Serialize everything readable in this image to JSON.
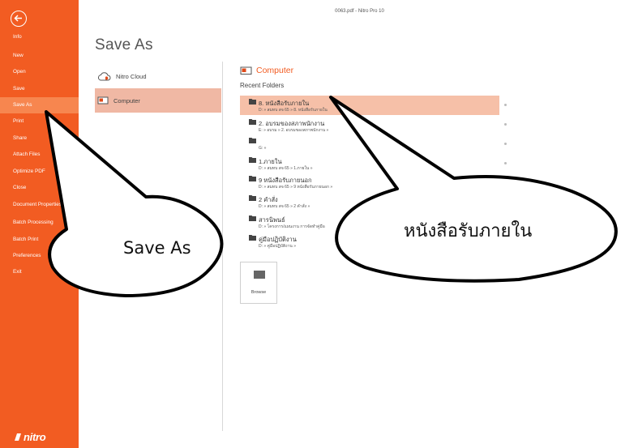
{
  "window": {
    "title": "0063.pdf - Nitro Pro 10"
  },
  "nav": {
    "back_icon": "back-arrow-icon",
    "items": [
      {
        "label": "Info"
      },
      {
        "label": "New"
      },
      {
        "label": "Open"
      },
      {
        "label": "Save"
      },
      {
        "label": "Save As",
        "active": true
      },
      {
        "label": "Print"
      },
      {
        "label": "Share"
      },
      {
        "label": "Attach Files"
      },
      {
        "label": "Optimize PDF"
      },
      {
        "label": "Close"
      },
      {
        "label": "Document Properties"
      },
      {
        "label": "Batch Processing"
      },
      {
        "label": "Batch Print"
      },
      {
        "label": "Preferences"
      },
      {
        "label": "Exit"
      }
    ],
    "logo": "nitro"
  },
  "main": {
    "title": "Save As",
    "locations": [
      {
        "label": "Nitro Cloud",
        "icon": "cloud-icon"
      },
      {
        "label": "Computer",
        "icon": "computer-icon",
        "active": true
      }
    ],
    "section_title": "Computer",
    "recent_title": "Recent Folders",
    "folders": [
      {
        "name": "8. หนังสือรับภายใน",
        "path": "D: » สมทบ สจ 65 » 8. หนังสือรับภายใน",
        "active": true
      },
      {
        "name": "2. อบรมของสภาพนักงาน",
        "path": "E: » อบรม » 2. อบรมของสภาพนักงาน »"
      },
      {
        "name": "",
        "path": "G: »"
      },
      {
        "name": "1.ภายใน",
        "path": "D: » สมทบ สจ 65 » 1.ภายใน »"
      },
      {
        "name": "9 หนังสือรับภายนอก",
        "path": "D: » สมทบ สจ 65 » 9 หนังสือรับภายนอก »"
      },
      {
        "name": "2 คำสั่ง",
        "path": "D: » สมทบ สจ 65 » 2 คำสั่ง »"
      },
      {
        "name": "สารนิพนธ์",
        "path": "D: » โครงการ/แผนงาน การจัดทำคู่มือ"
      },
      {
        "name": "คู่มือปฏิบัติงาน",
        "path": "D: » คู่มือปฏิบัติงาน »"
      }
    ],
    "browse_label": "Browse"
  },
  "callouts": [
    {
      "text": "Save As"
    },
    {
      "text": "หนังสือรับภายใน"
    }
  ],
  "colors": {
    "accent": "#f25c22",
    "nav_active": "#f7864f",
    "location_active": "#f0b8a4",
    "folder_active": "#f6c0a8"
  }
}
